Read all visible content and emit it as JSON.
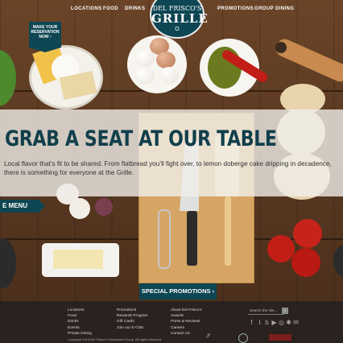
{
  "nav": {
    "left": [
      "LOCATIONS",
      "FOOD",
      "DRINKS"
    ],
    "right": [
      "PROMOTIONS",
      "GROUP DINING"
    ]
  },
  "logo": {
    "line1": "DEL FRISCO'S",
    "line2": "GRILLE",
    "line3": "O"
  },
  "reservation": {
    "line1": "MAKE YOUR",
    "line2": "RESERVATION",
    "line3": "NOW ›"
  },
  "hero": {
    "headline": "GRAB A SEAT AT OUR TABLE",
    "body": "Local flavor that’s fit to be shared. From flatbread you’ll fight over, to lemon doberge cake dripping in decadence, there is something for everyone at the Grille."
  },
  "menu_tab": "E MENU",
  "promotions_button": "SPECIAL PROMOTIONS ›",
  "footer": {
    "col1": [
      "Locations",
      "Food",
      "Drinks",
      "Events",
      "Private Dining"
    ],
    "col2": [
      "Promotions",
      "Rewards Program",
      "Gift Cards",
      "Join our E-Club"
    ],
    "col3": [
      "About Del Frisco's",
      "Awards",
      "Press & Reviews",
      "Careers",
      "Contact Us"
    ],
    "search_placeholder": "Search the site...",
    "search_button": "›",
    "copyright": "Copyright 2015 Del Frisco's Restaurant Group. All rights reserved."
  },
  "icons": [
    "facebook-icon",
    "twitter-icon",
    "blog-icon",
    "youtube-icon",
    "instagram-icon",
    "yelp-icon",
    "email-icon"
  ],
  "colors": {
    "brand_teal": "#0e4653",
    "overlay": "#f0eee9",
    "footer_bg": "#2a221e"
  }
}
